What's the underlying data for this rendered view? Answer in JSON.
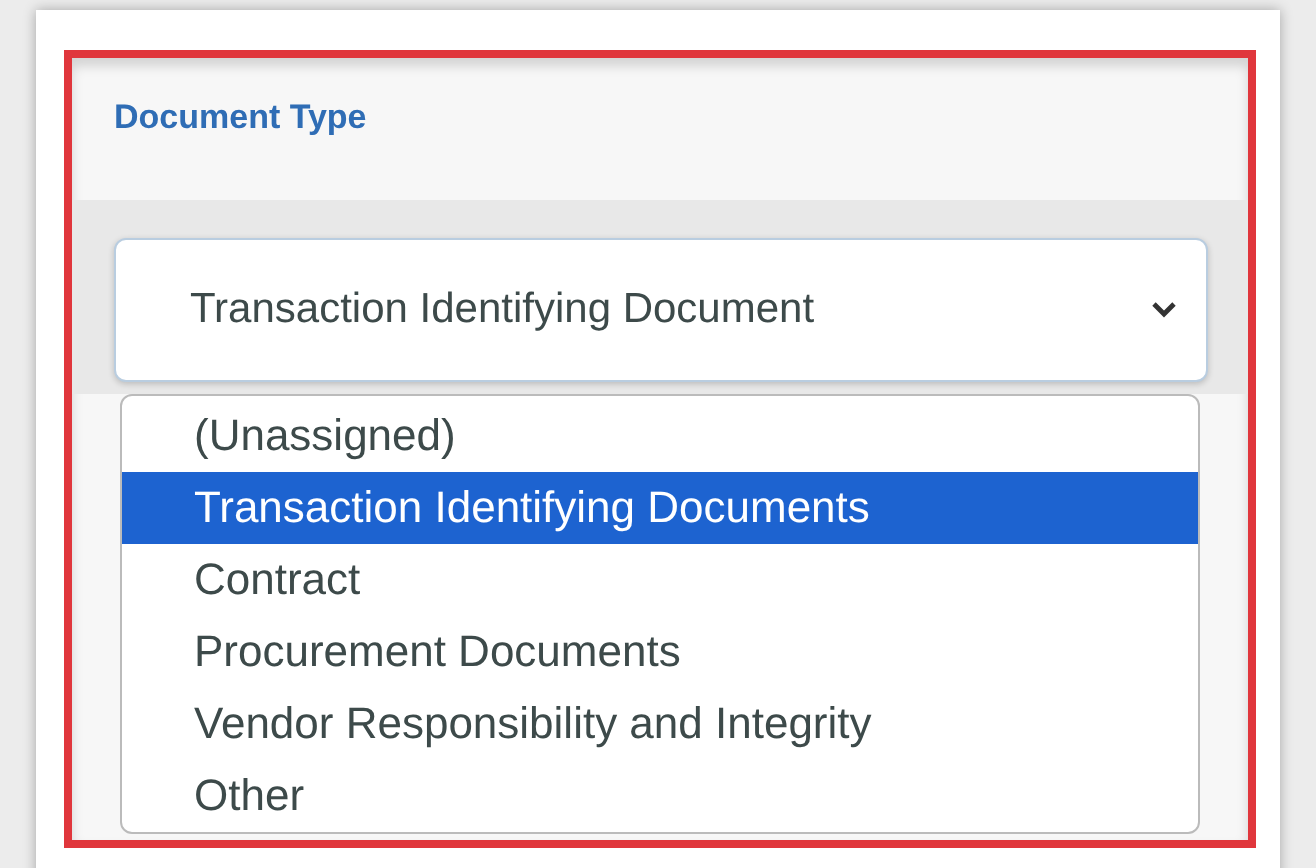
{
  "field": {
    "label": "Document Type",
    "value": "Transaction Identifying Document",
    "expanded": true
  },
  "options": [
    {
      "label": "(Unassigned)",
      "selected": false
    },
    {
      "label": "Transaction Identifying Documents",
      "selected": true
    },
    {
      "label": "Contract",
      "selected": false
    },
    {
      "label": "Procurement Documents",
      "selected": false
    },
    {
      "label": "Vendor Responsibility and Integrity",
      "selected": false
    },
    {
      "label": "Other",
      "selected": false
    }
  ]
}
